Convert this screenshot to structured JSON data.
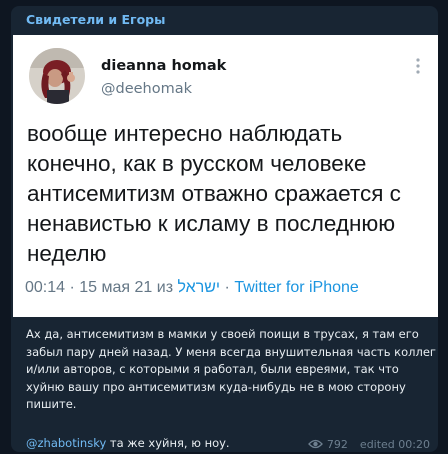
{
  "channel": {
    "name": "Свидетели и Егоры"
  },
  "tweet": {
    "author_name": "dieanna homak",
    "author_handle": "@deehomak",
    "text": "вообще интересно наблюдать конечно, как в русском человеке антисемитизм отважно сражается с ненавистью к исламу в последнюю неделю",
    "time": "00:14",
    "date": "15 мая 21",
    "from_word": "из",
    "location": "ישראל",
    "separator": " · ",
    "source": "Twitter for iPhone",
    "more_icon": "more-vertical-icon"
  },
  "post": {
    "caption": "Ах да, антисемитизм в мамки у своей поищи в трусах, я там его забыл пару дней назад. У меня всегда внушительная часть коллег и/или авторов, с которыми я работал, были евреями, так что хуйню вашу про антисемитизм куда-нибудь не в мою сторону пишите.",
    "reply_mention": "@zhabotinsky",
    "reply_text": " та же хуйня, ю ноу.",
    "views": "792",
    "edited_label": "edited",
    "edited_time": "00:20"
  },
  "colors": {
    "background": "#0e1621",
    "bubble": "#182533",
    "link": "#71baf3",
    "twitter_link": "#1b95e0"
  }
}
